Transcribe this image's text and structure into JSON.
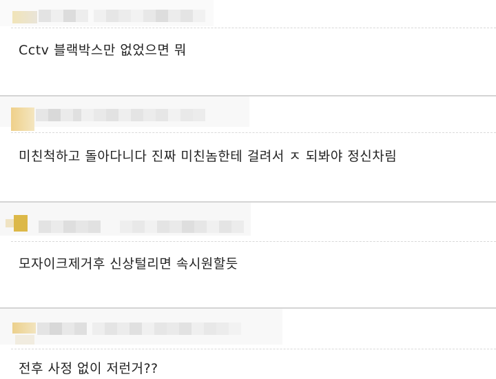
{
  "comments": [
    {
      "text": "Cctv 블랙박스만 없었으면 뭐"
    },
    {
      "text": "미친척하고 돌아다니다 진짜 미친놈한테 걸려서 ㅈ 되봐야 정신차림"
    },
    {
      "text": "모자이크제거후 신상털리면 속시원할듯"
    },
    {
      "text": "전후 사정 없이 저런거??"
    }
  ],
  "colors": {
    "separator": "#d4d4d4",
    "avatar_gold": "#e8c66a",
    "text": "#222222"
  }
}
